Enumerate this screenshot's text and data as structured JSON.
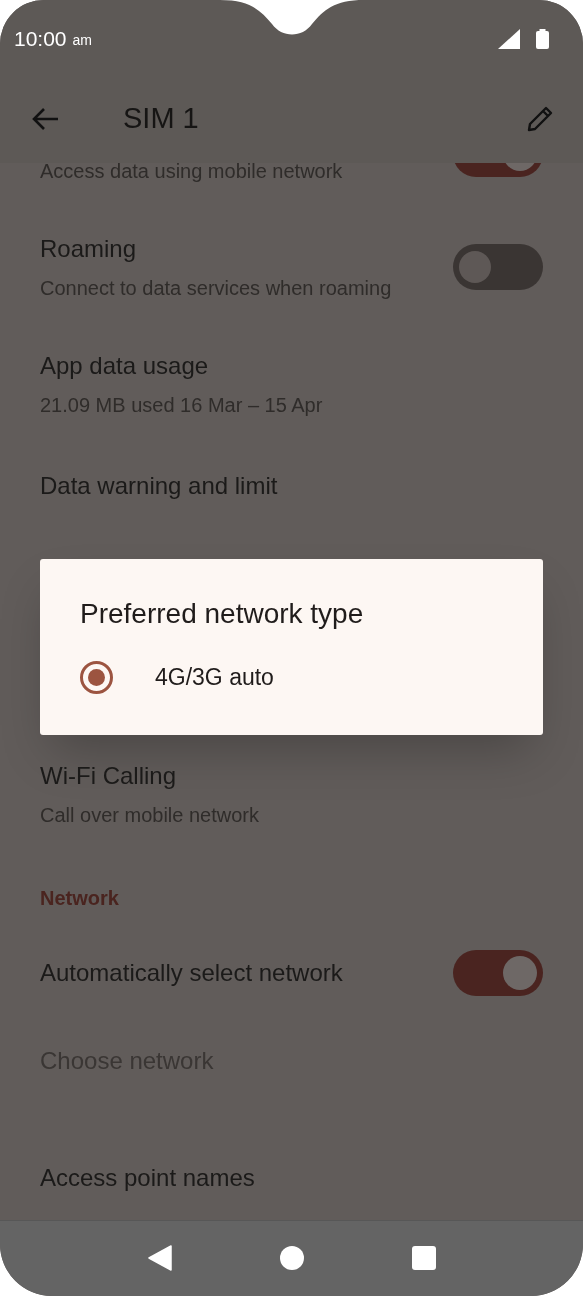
{
  "status_bar": {
    "time": "10:00",
    "time_suffix": "am"
  },
  "app_bar": {
    "title": "SIM 1"
  },
  "settings": [
    {
      "kind": "item",
      "subtitle": "Access data using mobile network",
      "toggle": {
        "on": true
      }
    },
    {
      "kind": "item",
      "title": "Roaming",
      "subtitle": "Connect to data services when roaming",
      "toggle": {
        "on": false
      }
    },
    {
      "kind": "item",
      "title": "App data usage",
      "subtitle": "21.09 MB used 16 Mar – 15 Apr"
    },
    {
      "kind": "item",
      "title": "Data warning and limit"
    },
    {
      "kind": "item",
      "title": "Wi-Fi Calling",
      "subtitle": "Call over mobile network"
    },
    {
      "kind": "header",
      "title": "Network"
    },
    {
      "kind": "item",
      "title": "Automatically select network",
      "toggle": {
        "on": true
      }
    },
    {
      "kind": "item",
      "title": "Choose network",
      "disabled": true
    },
    {
      "kind": "item",
      "title": "Access point names"
    }
  ],
  "dialog": {
    "title": "Preferred network type",
    "options": [
      {
        "label": "4G/3G auto",
        "selected": true
      }
    ]
  }
}
